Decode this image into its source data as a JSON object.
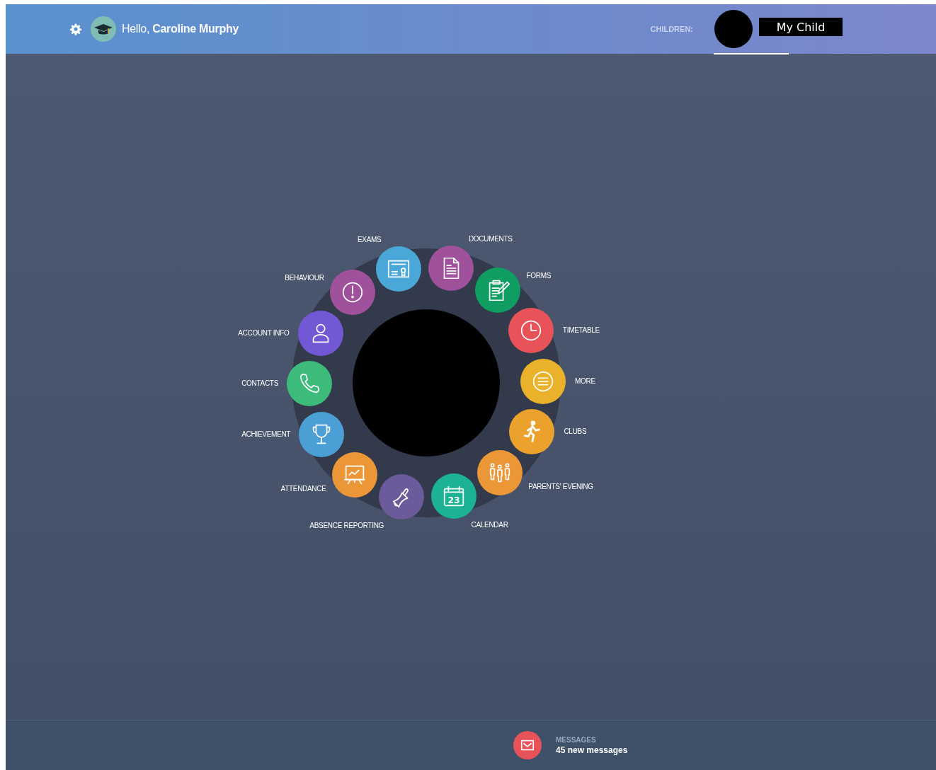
{
  "header": {
    "greeting": "Hello, **Caroline Murphy**",
    "children_label": "CHILDREN:",
    "child_name": "My Child"
  },
  "menu": [
    {
      "label": "EXAMS",
      "kind": "exams",
      "color": "#4aa8d8"
    },
    {
      "label": "DOCUMENTS",
      "kind": "documents",
      "color": "#a0519c"
    },
    {
      "label": "BEHAVIOUR",
      "kind": "behaviour",
      "color": "#a0519c"
    },
    {
      "label": "FORMS",
      "kind": "forms",
      "color": "#0f9d62"
    },
    {
      "label": "ACCOUNT INFO",
      "kind": "account",
      "color": "#7358d6"
    },
    {
      "label": "TIMETABLE",
      "kind": "timetable",
      "color": "#e8535a"
    },
    {
      "label": "CONTACTS",
      "kind": "contacts",
      "color": "#3cbb7a"
    },
    {
      "label": "MORE",
      "kind": "more",
      "color": "#e9b22a"
    },
    {
      "label": "ACHIEVEMENT",
      "kind": "achievement",
      "color": "#4b9fd4"
    },
    {
      "label": "CLUBS",
      "kind": "clubs",
      "color": "#eba22d"
    },
    {
      "label": "ATTENDANCE",
      "kind": "attendance",
      "color": "#ec9737"
    },
    {
      "label": "PARENTS' EVENING",
      "kind": "parents",
      "color": "#ec9737"
    },
    {
      "label": "ABSENCE REPORTING",
      "kind": "absence",
      "color": "#6b5b9a"
    },
    {
      "label": "CALENDAR",
      "kind": "calendar",
      "color": "#1bb394",
      "icon_text": "23"
    }
  ],
  "footer": {
    "title": "MESSAGES",
    "text": "45 new messages"
  }
}
